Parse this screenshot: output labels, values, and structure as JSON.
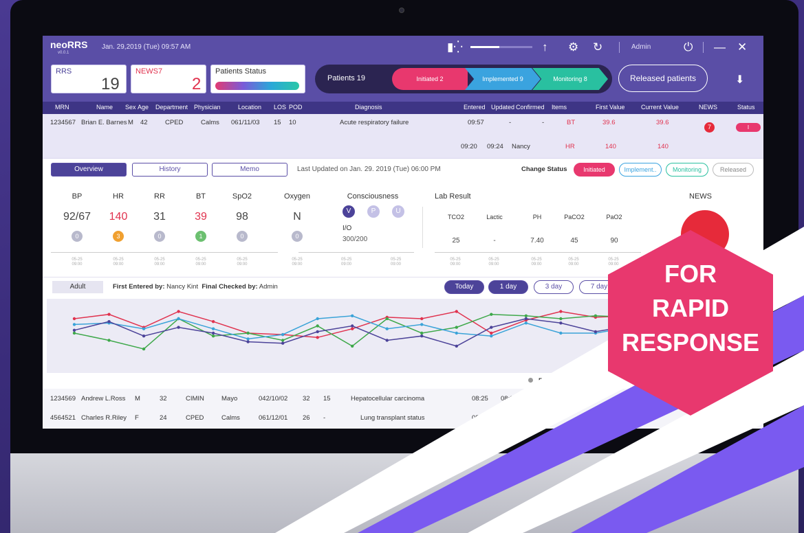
{
  "app": {
    "name": "neoRRS",
    "version": "v0.0.1",
    "datetime": "Jan. 29,2019 (Tue) 09:57 AM",
    "user": "Admin"
  },
  "summary": {
    "rrs_label": "RRS",
    "rrs_value": "19",
    "news7_label": "NEWS7",
    "news7_value": "2",
    "patients_status_label": "Patients Status",
    "pipeline_label": "Patients 19",
    "initiated": "Initiated 2",
    "implemented": "Implemented 9",
    "monitoring": "Monitoring 8",
    "released_button": "Released patients"
  },
  "table": {
    "headers": [
      "MRN",
      "Name",
      "Sex",
      "Age",
      "Department",
      "Physician",
      "Location",
      "LOS",
      "POD",
      "Diagnosis",
      "Entered",
      "Updated",
      "Confirmed",
      "Items",
      "First Value",
      "Current Value",
      "NEWS",
      "Status"
    ],
    "selected_row": {
      "mrn": "1234567",
      "name": "Brian E. Barnes",
      "sex": "M",
      "age": "42",
      "department": "CPED",
      "physician": "Calms",
      "location": "061/11/03",
      "los": "15",
      "pod": "10",
      "diagnosis": "Acute respiratory failure",
      "entered": "09:57",
      "updated": "-",
      "confirmed": "-",
      "item": "BT",
      "first": "39.6",
      "current": "39.6",
      "news": "7",
      "status": "I",
      "sub_entered": "09:20",
      "sub_updated": "09:24",
      "sub_confirmed": "Nancy",
      "sub_item": "HR",
      "sub_first": "140",
      "sub_current": "140"
    },
    "rows": [
      {
        "mrn": "1234569",
        "name": "Andrew L.Ross",
        "sex": "M",
        "age": "32",
        "department": "CIMIN",
        "physician": "Mayo",
        "location": "042/10/02",
        "los": "32",
        "pod": "15",
        "diagnosis": "Hepatocellular carcinoma",
        "entered": "08:25",
        "updated": "08:38"
      },
      {
        "mrn": "4564521",
        "name": "Charles R.Riley",
        "sex": "F",
        "age": "24",
        "department": "CPED",
        "physician": "Calms",
        "location": "061/12/01",
        "los": "26",
        "pod": "-",
        "diagnosis": "Lung transplant status",
        "entered": "08:2"
      }
    ]
  },
  "detail": {
    "tabs": [
      "Overview",
      "History",
      "Memo"
    ],
    "last_updated": "Last Updated on Jan. 29. 2019 (Tue) 06:00 PM",
    "change_status_label": "Change Status",
    "status_buttons": [
      "Initiated",
      "Implement..",
      "Monitoring",
      "Released"
    ],
    "vitals": [
      {
        "label": "BP",
        "value": "92/67",
        "score": "0",
        "date": "05-25",
        "time": "09:00"
      },
      {
        "label": "HR",
        "value": "140",
        "score": "3",
        "date": "05-25",
        "time": "09:00"
      },
      {
        "label": "RR",
        "value": "31",
        "score": "0",
        "date": "05-25",
        "time": "09:00"
      },
      {
        "label": "BT",
        "value": "39",
        "score": "1",
        "date": "05-25",
        "time": "09:00"
      },
      {
        "label": "SpO2",
        "value": "98",
        "score": "0",
        "date": "05-25",
        "time": "09:00"
      },
      {
        "label": "Oxygen",
        "value": "N",
        "score": "0",
        "date": "05-25",
        "time": "09:00"
      }
    ],
    "consciousness_label": "Consciousness",
    "consciousness": [
      "V",
      "P",
      "U"
    ],
    "io_label": "I/O",
    "io_value": "300/200",
    "lab_label": "Lab Result",
    "labs": [
      {
        "label": "TCO2",
        "value": "25"
      },
      {
        "label": "Lactic",
        "value": "-"
      },
      {
        "label": "PH",
        "value": "7.40"
      },
      {
        "label": "PaCO2",
        "value": "45"
      },
      {
        "label": "PaO2",
        "value": "90"
      }
    ],
    "lab_date": "05-25",
    "lab_time": "09:00",
    "news_label": "NEWS",
    "adult": "Adult",
    "first_entered_label": "First Entered by:",
    "first_entered": "Nancy Kint",
    "final_checked_label": "Final Checked by:",
    "final_checked": "Admin",
    "ranges": [
      "Today",
      "1 day",
      "3 day",
      "7 day"
    ],
    "legend": "BP"
  },
  "chart_data": {
    "type": "line",
    "x": [
      0,
      1,
      2,
      3,
      4,
      5,
      6,
      7,
      8,
      9,
      10,
      11,
      12,
      13,
      14,
      15,
      16,
      17,
      18,
      19
    ],
    "series": [
      {
        "color": "#e0324e",
        "values": [
          60,
          66,
          48,
          70,
          56,
          40,
          38,
          34,
          46,
          62,
          60,
          70,
          40,
          58,
          70,
          62,
          64,
          58,
          52,
          60
        ]
      },
      {
        "color": "#3ea84a",
        "values": [
          40,
          30,
          18,
          60,
          36,
          40,
          30,
          50,
          22,
          60,
          40,
          48,
          66,
          64,
          60,
          64,
          62,
          28,
          60,
          48
        ]
      },
      {
        "color": "#3aa3d8",
        "values": [
          52,
          54,
          46,
          60,
          46,
          32,
          38,
          60,
          64,
          46,
          52,
          40,
          36,
          54,
          40,
          40,
          48,
          46,
          60,
          56
        ]
      },
      {
        "color": "#4c4399",
        "values": [
          44,
          56,
          36,
          48,
          40,
          28,
          26,
          42,
          50,
          30,
          36,
          22,
          48,
          60,
          54,
          42,
          50,
          56,
          58,
          52
        ]
      }
    ]
  },
  "colors": {
    "brand": "#5a4ea6",
    "accent": "#e8386e",
    "implemented": "#3aa3df",
    "monitoring": "#29c0a0"
  },
  "overlay": {
    "line1": "FOR",
    "line2": "RAPID",
    "line3": "RESPONSE"
  }
}
